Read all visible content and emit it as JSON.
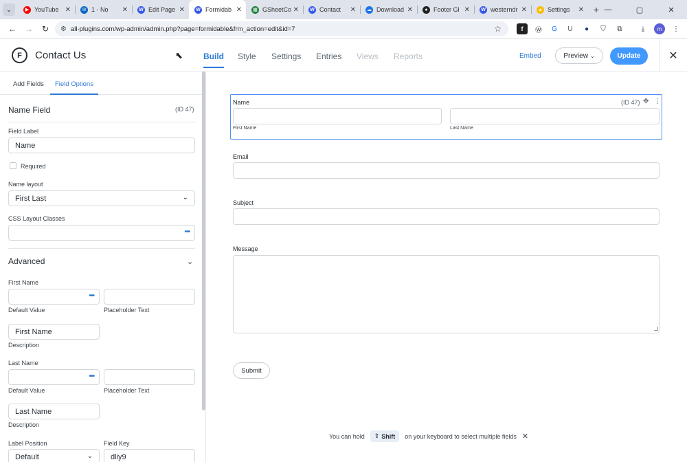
{
  "browser": {
    "tabs": [
      {
        "title": "YouTube",
        "color": "#ff0000",
        "glyph": "▶",
        "active": false
      },
      {
        "title": "1 - No",
        "color": "#0a66c2",
        "glyph": "✉",
        "active": false
      },
      {
        "title": "Edit Page",
        "color": "#3858e9",
        "glyph": "W",
        "active": false
      },
      {
        "title": "Formidab",
        "color": "#3858e9",
        "glyph": "W",
        "active": true
      },
      {
        "title": "GSheetCo",
        "color": "#188038",
        "glyph": "▦",
        "active": false
      },
      {
        "title": "Contact",
        "color": "#3858e9",
        "glyph": "W",
        "active": false
      },
      {
        "title": "Download",
        "color": "#1a73e8",
        "glyph": "☁",
        "active": false
      },
      {
        "title": "Footer Gl",
        "color": "#222222",
        "glyph": "●",
        "active": false
      },
      {
        "title": "westerndr",
        "color": "#3858e9",
        "glyph": "W",
        "active": false
      },
      {
        "title": "Settings",
        "color": "#fbbc04",
        "glyph": "▲",
        "active": false
      }
    ],
    "url": "all-plugins.com/wp-admin/admin.php?page=formidable&frm_action=edit&id=7"
  },
  "header": {
    "title": "Contact Us",
    "nav": {
      "build": "Build",
      "style": "Style",
      "settings": "Settings",
      "entries": "Entries",
      "views": "Views",
      "reports": "Reports"
    },
    "embed": "Embed",
    "preview": "Preview",
    "update": "Update"
  },
  "sidebar": {
    "tabs": {
      "add_fields": "Add Fields",
      "field_options": "Field Options"
    },
    "field_title": "Name Field",
    "field_id": "(ID 47)",
    "field_label_label": "Field Label",
    "field_label_value": "Name",
    "required_label": "Required",
    "name_layout_label": "Name layout",
    "name_layout_value": "First Last",
    "css_classes_label": "CSS Layout Classes",
    "advanced_label": "Advanced",
    "first_name": {
      "heading": "First Name",
      "default_value_label": "Default Value",
      "placeholder_label": "Placeholder Text",
      "description_value": "First Name",
      "description_label": "Description"
    },
    "last_name": {
      "heading": "Last Name",
      "default_value_label": "Default Value",
      "placeholder_label": "Placeholder Text",
      "description_value": "Last Name",
      "description_label": "Description"
    },
    "label_position_label": "Label Position",
    "label_position_value": "Default",
    "field_key_label": "Field Key",
    "field_key_value": "dliy9"
  },
  "canvas": {
    "name_label": "Name",
    "name_id": "(ID 47)",
    "first_name_sub": "First Name",
    "last_name_sub": "Last Name",
    "email_label": "Email",
    "subject_label": "Subject",
    "message_label": "Message",
    "submit": "Submit",
    "hint_before": "You can hold",
    "hint_key": "Shift",
    "hint_after": "on your keyboard to select multiple fields"
  },
  "colors": {
    "accent": "#2d7ad6",
    "update_button": "#4199fd",
    "selected_border": "#4e8ff0"
  }
}
